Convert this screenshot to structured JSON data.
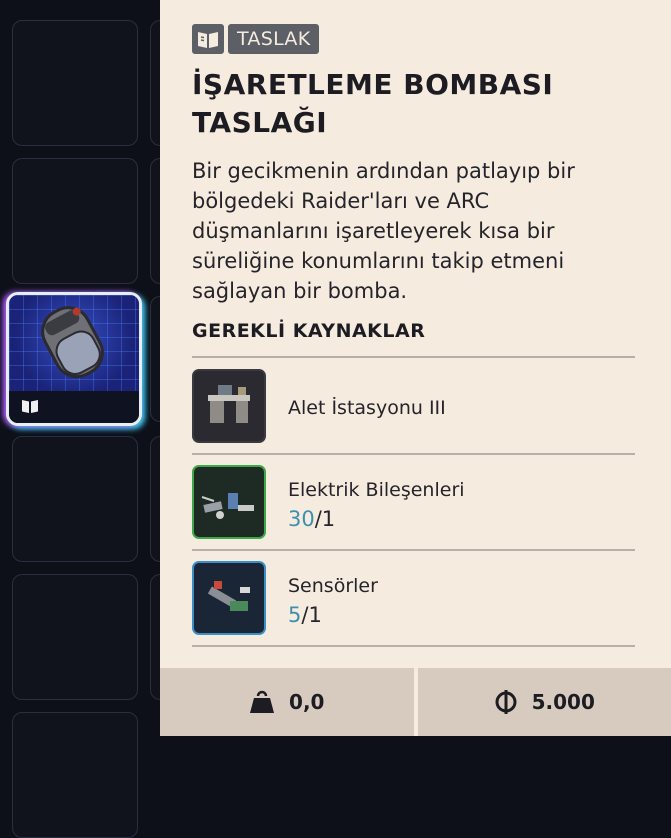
{
  "tooltip": {
    "tag_label": "TASLAK",
    "title": "İŞARETLEME BOMBASI TASLAĞI",
    "description": "Bir gecikmenin ardından patlayıp bir bölgedeki Raider'ları ve ARC düşmanlarını işaretleyerek kısa bir süreliğine konumlarını takip etmeni sağlayan bir bomba.",
    "requirements_heading": "GEREKLİ KAYNAKLAR",
    "requirements": [
      {
        "name": "Alet İstasyonu III",
        "icon": "workbench-icon",
        "accent": "#2a2830"
      },
      {
        "name": "Elektrik Bileşenleri",
        "have": "30",
        "need": "/1",
        "icon": "electrical-components-icon",
        "accent": "#3fa64a"
      },
      {
        "name": "Sensörler",
        "have": "5",
        "need": "/1",
        "icon": "sensors-icon",
        "accent": "#3b8fc4"
      }
    ],
    "footer": {
      "weight_value": "0,0",
      "price_value": "5.000"
    }
  },
  "colors": {
    "card_bg": "#f5ebdf",
    "tag_bg": "#5d5f66",
    "count_have": "#3e8fae",
    "selected_glow_left": "#b35cff",
    "selected_glow_right": "#3fd7ff"
  }
}
